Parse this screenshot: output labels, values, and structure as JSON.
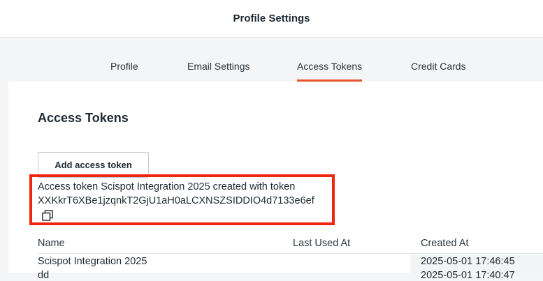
{
  "header": {
    "title": "Profile Settings"
  },
  "tabs": [
    {
      "label": "Profile",
      "active": false
    },
    {
      "label": "Email Settings",
      "active": false
    },
    {
      "label": "Access Tokens",
      "active": true
    },
    {
      "label": "Credit Cards",
      "active": false
    }
  ],
  "accent_color": "#e8532b",
  "highlight_color": "#f0250f",
  "main": {
    "section_title": "Access Tokens",
    "add_button_label": "Add access token",
    "notice_line1": "Access token Scispot Integration 2025 created with token",
    "notice_line2": "XXKkrT6XBe1jzqnkT2GjU1aH0aLCXNSZSIDDIO4d7133e6ef",
    "copy_icon": "copy-icon"
  },
  "table": {
    "columns": [
      "Name",
      "Last Used At",
      "Created At"
    ],
    "rows": [
      {
        "name": "Scispot Integration 2025",
        "last_used_at": "",
        "created_at": "2025-05-01 17:46:45"
      },
      {
        "name": "dd",
        "last_used_at": "",
        "created_at": "2025-05-01 17:40:47"
      }
    ]
  }
}
